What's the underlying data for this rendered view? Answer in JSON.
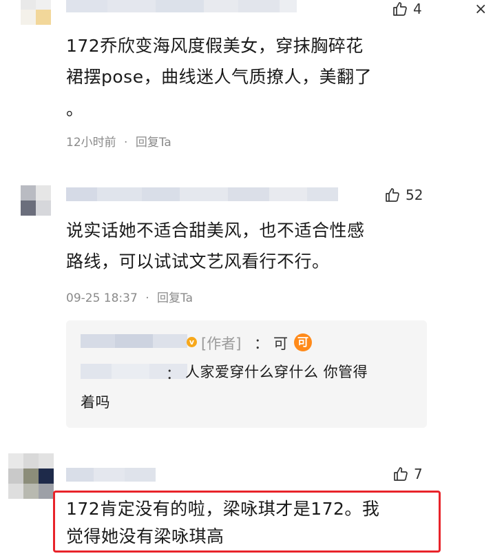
{
  "close_icon_glyph": "×",
  "comments": [
    {
      "likes": "4",
      "text_line1": "172乔欣变海风度假美女，穿抹胸碎花",
      "text_line2": "裙摆pose，曲线迷人气质撩人，美翻了",
      "text_line3": "。",
      "time": "12小时前",
      "reply_label": "回复Ta"
    },
    {
      "likes": "52",
      "text_line1": "说实话她不适合甜美风，也不适合性感",
      "text_line2": "路线，可以试试文艺风看行不行。",
      "time": "09-25 18:37",
      "reply_label": "回复Ta",
      "sub_reply": {
        "author_tag": "[作者]",
        "author_reply": "可",
        "author_badge": "可",
        "colon": "：",
        "text_line1": "人家爱穿什么穿什么 你管得",
        "text_line2": "着吗"
      }
    },
    {
      "likes": "7",
      "text_line1": "172肯定没有的啦，梁咏琪才是172。我",
      "text_line2": "觉得她没有梁咏琪高"
    }
  ],
  "separator": "·",
  "colors": {
    "highlight_border": "#e8232a",
    "verified_badge": "#f7a81b",
    "author_badge": "#ff8a1a",
    "meta_text": "#8a8a8a"
  },
  "icons": {
    "like": "thumbs-up-outline-icon",
    "close": "close-icon",
    "verified": "verified-badge-icon"
  }
}
